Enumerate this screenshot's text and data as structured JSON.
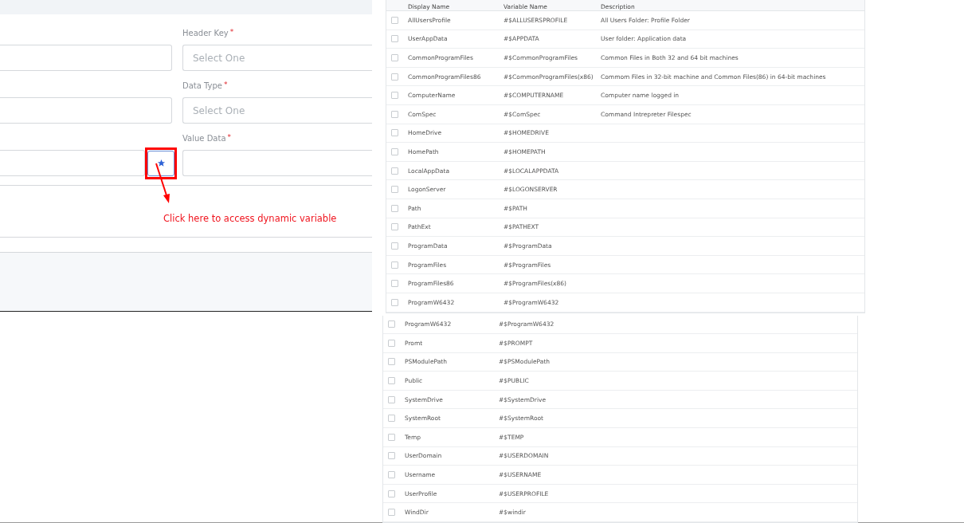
{
  "form": {
    "fields": [
      {
        "label": "Header Key",
        "required_mark": "*",
        "placeholder": "Select One"
      },
      {
        "label": "Data Type",
        "required_mark": "*",
        "placeholder": "Select One"
      },
      {
        "label": "Value Data",
        "required_mark": "*"
      }
    ],
    "variable_button": {
      "highlighted": true
    },
    "annotation": "Click here to access dynamic variable"
  },
  "variables_table": {
    "columns": [
      "Display Name",
      "Variable Name",
      "Description"
    ],
    "rows": [
      {
        "display_name": "AllUsersProfile",
        "variable_name": "#$ALLUSERSPROFILE",
        "description": "All Users Folder: Profile Folder",
        "checked": false
      },
      {
        "display_name": "UserAppData",
        "variable_name": "#$APPDATA",
        "description": "User folder: Application data",
        "checked": false
      },
      {
        "display_name": "CommonProgramFiles",
        "variable_name": "#$CommonProgramFiles",
        "description": "Common Files in Both 32 and 64 bit machines",
        "checked": false
      },
      {
        "display_name": "CommonProgramFiles86",
        "variable_name": "#$CommonProgramFiles(x86)",
        "description": "Commom Files in 32-bit machine and Common Files(86) in 64-bit machines",
        "checked": false
      },
      {
        "display_name": "ComputerName",
        "variable_name": "#$COMPUTERNAME",
        "description": "Computer name logged in",
        "checked": false
      },
      {
        "display_name": "ComSpec",
        "variable_name": "#$ComSpec",
        "description": "Command Intrepreter Filespec",
        "checked": false
      },
      {
        "display_name": "HomeDrive",
        "variable_name": "#$HOMEDRIVE",
        "checked": false
      },
      {
        "display_name": "HomePath",
        "variable_name": "#$HOMEPATH",
        "checked": false
      },
      {
        "display_name": "LocalAppData",
        "variable_name": "#$LOCALAPPDATA",
        "checked": false
      },
      {
        "display_name": "LogonServer",
        "variable_name": "#$LOGONSERVER",
        "checked": false
      },
      {
        "display_name": "Path",
        "variable_name": "#$PATH",
        "checked": false
      },
      {
        "display_name": "PathExt",
        "variable_name": "#$PATHEXT",
        "checked": false
      },
      {
        "display_name": "ProgramData",
        "variable_name": "#$ProgramData",
        "checked": false
      },
      {
        "display_name": "ProgramFiles",
        "variable_name": "#$ProgramFiles",
        "checked": false
      },
      {
        "display_name": "ProgramFiles86",
        "variable_name": "#$ProgramFiles(x86)",
        "checked": false
      },
      {
        "display_name": "ProgramW6432",
        "variable_name": "#$ProgramW6432",
        "checked": false
      }
    ]
  },
  "variables_table_continued": {
    "rows": [
      {
        "display_name": "ProgramW6432",
        "variable_name": "#$ProgramW6432",
        "checked": false
      },
      {
        "display_name": "Promt",
        "variable_name": "#$PROMPT",
        "checked": false
      },
      {
        "display_name": "PSModulePath",
        "variable_name": "#$PSModulePath",
        "checked": false
      },
      {
        "display_name": "Public",
        "variable_name": "#$PUBLIC",
        "checked": false
      },
      {
        "display_name": "SystemDrive",
        "variable_name": "#$SystemDrive",
        "checked": false
      },
      {
        "display_name": "SystemRoot",
        "variable_name": "#$SystemRoot",
        "checked": false
      },
      {
        "display_name": "Temp",
        "variable_name": "#$TEMP",
        "checked": false
      },
      {
        "display_name": "UserDomain",
        "variable_name": "#$USERDOMAIN",
        "checked": false
      },
      {
        "display_name": "Username",
        "variable_name": "#$USERNAME",
        "checked": false
      },
      {
        "display_name": "UserProfile",
        "variable_name": "#$USERPROFILE",
        "checked": false
      },
      {
        "display_name": "WindDir",
        "variable_name": "#$windir",
        "checked": false
      }
    ]
  }
}
